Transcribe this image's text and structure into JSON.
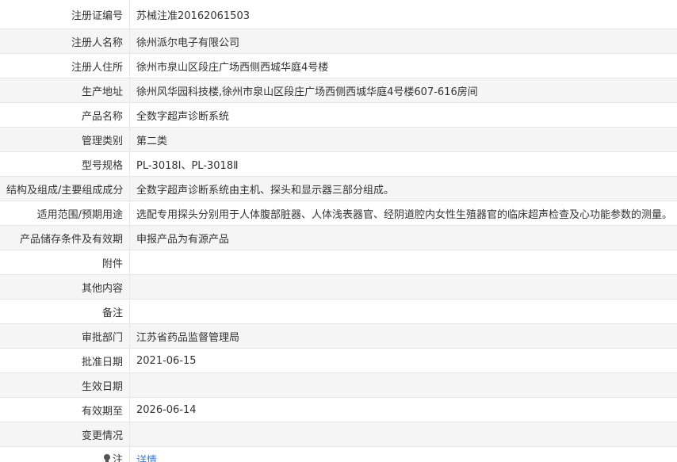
{
  "rows": [
    {
      "label": "注册证编号",
      "value": "苏械注准20162061503"
    },
    {
      "label": "注册人名称",
      "value": "徐州派尔电子有限公司"
    },
    {
      "label": "注册人住所",
      "value": "徐州市泉山区段庄广场西侧西城华庭4号楼"
    },
    {
      "label": "生产地址",
      "value": "徐州风华园科技楼,徐州市泉山区段庄广场西侧西城华庭4号楼607-616房间"
    },
    {
      "label": "产品名称",
      "value": "全数字超声诊断系统"
    },
    {
      "label": "管理类别",
      "value": "第二类"
    },
    {
      "label": "型号规格",
      "value": "PL-3018Ⅰ、PL-3018Ⅱ"
    },
    {
      "label": "结构及组成/主要组成成分",
      "value": "全数字超声诊断系统由主机、探头和显示器三部分组成。"
    },
    {
      "label": "适用范围/预期用途",
      "value": "选配专用探头分别用于人体腹部脏器、人体浅表器官、经阴道腔内女性生殖器官的临床超声检查及心功能参数的测量。"
    },
    {
      "label": "产品储存条件及有效期",
      "value": "申报产品为有源产品"
    },
    {
      "label": "附件",
      "value": ""
    },
    {
      "label": "其他内容",
      "value": ""
    },
    {
      "label": "备注",
      "value": ""
    },
    {
      "label": "审批部门",
      "value": "江苏省药品监督管理局"
    },
    {
      "label": "批准日期",
      "value": "2021-06-15"
    },
    {
      "label": "生效日期",
      "value": ""
    },
    {
      "label": "有效期至",
      "value": "2026-06-14"
    },
    {
      "label": "变更情况",
      "value": ""
    }
  ],
  "note": {
    "icon": "lightbulb-icon",
    "label": "注",
    "link_text": "详情"
  },
  "colors": {
    "link": "#3a7bd5",
    "stripe": "#f5f5f5",
    "border": "#e6e6e6"
  }
}
